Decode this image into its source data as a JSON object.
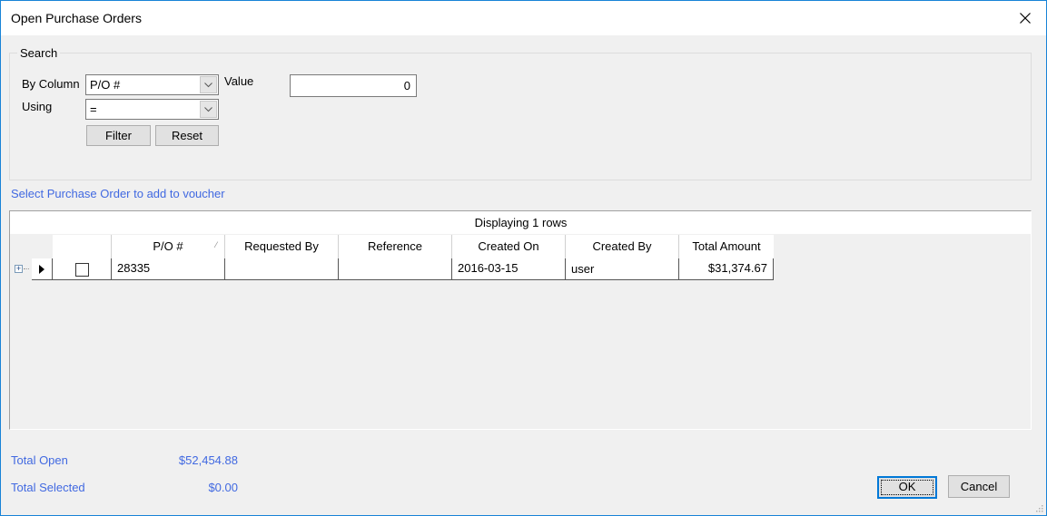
{
  "window": {
    "title": "Open Purchase Orders",
    "close_icon": "close-icon"
  },
  "search": {
    "group_label": "Search",
    "by_column_label": "By Column",
    "by_column_value": "P/O #",
    "using_label": "Using",
    "using_value": "=",
    "value_label": "Value",
    "value_input": "0",
    "filter_button": "Filter",
    "reset_button": "Reset"
  },
  "hint": "Select Purchase Order to add to voucher",
  "grid": {
    "caption": "Displaying 1 rows",
    "columns": [
      "P/O #",
      "Requested By",
      "Reference",
      "Created On",
      "Created By",
      "Total Amount"
    ],
    "rows": [
      {
        "selected": false,
        "po": "28335",
        "requested_by": "",
        "reference": "",
        "created_on": "2016-03-15",
        "created_by": "user",
        "total_amount": "$31,374.67"
      }
    ]
  },
  "summary": {
    "total_open_label": "Total Open",
    "total_open_value": "$52,454.88",
    "total_selected_label": "Total Selected",
    "total_selected_value": "$0.00"
  },
  "buttons": {
    "ok": "OK",
    "cancel": "Cancel"
  },
  "colors": {
    "accent": "#0078d7",
    "link_text": "#4169e1",
    "window_border": "#1883d7"
  }
}
